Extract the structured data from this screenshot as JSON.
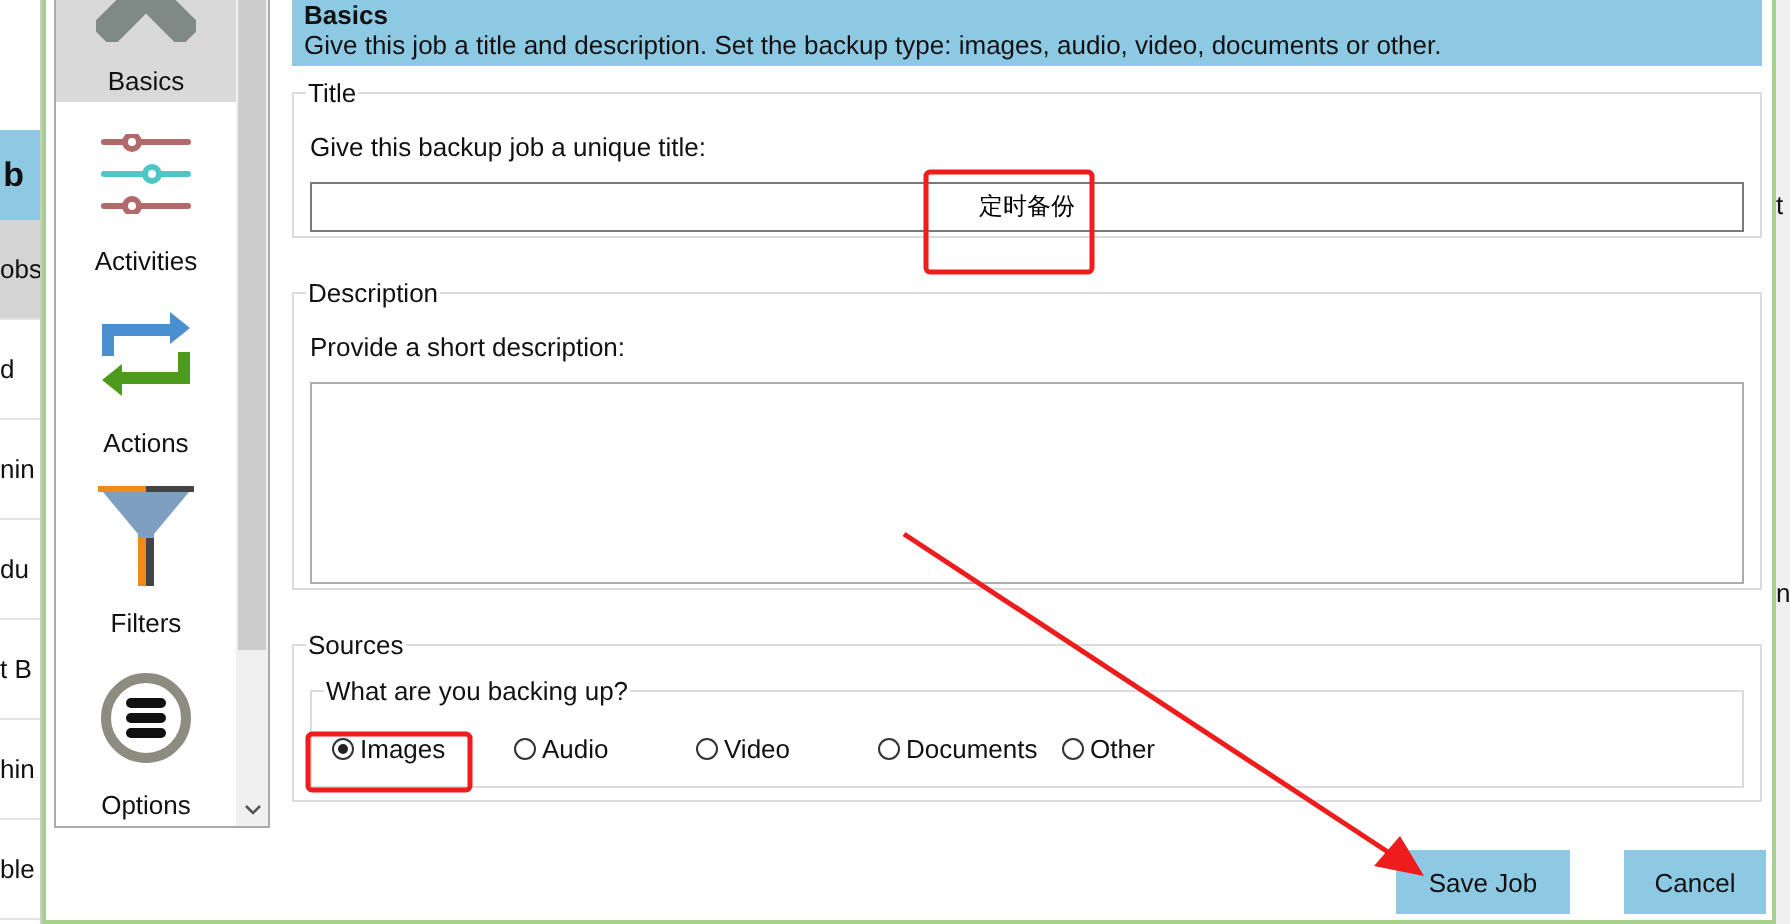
{
  "background_window": {
    "header": "b",
    "rows": [
      {
        "label": "obs",
        "selected": true
      },
      {
        "label": "d",
        "selected": false
      },
      {
        "label": "nin",
        "selected": false
      },
      {
        "label": "du",
        "selected": false
      },
      {
        "label": "t B",
        "selected": false
      },
      {
        "label": "hin",
        "selected": false
      },
      {
        "label": "ble",
        "selected": false
      }
    ],
    "right_fragments": [
      "t",
      "n"
    ]
  },
  "sidebar": {
    "items": [
      {
        "label": "Basics",
        "kind": "cross",
        "selected": true
      },
      {
        "label": "Activities",
        "kind": "sliders",
        "selected": false
      },
      {
        "label": "Actions",
        "kind": "repeat",
        "selected": false
      },
      {
        "label": "Filters",
        "kind": "funnel",
        "selected": false
      },
      {
        "label": "Options",
        "kind": "stack",
        "selected": false
      }
    ]
  },
  "header": {
    "title": "Basics",
    "description": "Give this job a title and description. Set the backup type: images, audio, video, documents or other."
  },
  "title_group": {
    "legend": "Title",
    "prompt": "Give this backup job a unique title:",
    "value": "定时备份"
  },
  "description_group": {
    "legend": "Description",
    "prompt": "Provide a short description:"
  },
  "sources": {
    "legend": "Sources",
    "question": "What are you backing up?",
    "options": [
      {
        "label": "Images",
        "selected": true
      },
      {
        "label": "Audio",
        "selected": false
      },
      {
        "label": "Video",
        "selected": false
      },
      {
        "label": "Documents",
        "selected": false
      },
      {
        "label": "Other",
        "selected": false
      }
    ]
  },
  "buttons": [
    "Save Job",
    "Cancel"
  ],
  "annotations": [
    {
      "kind": "box"
    },
    {
      "kind": "box"
    },
    {
      "kind": "arrow"
    }
  ]
}
